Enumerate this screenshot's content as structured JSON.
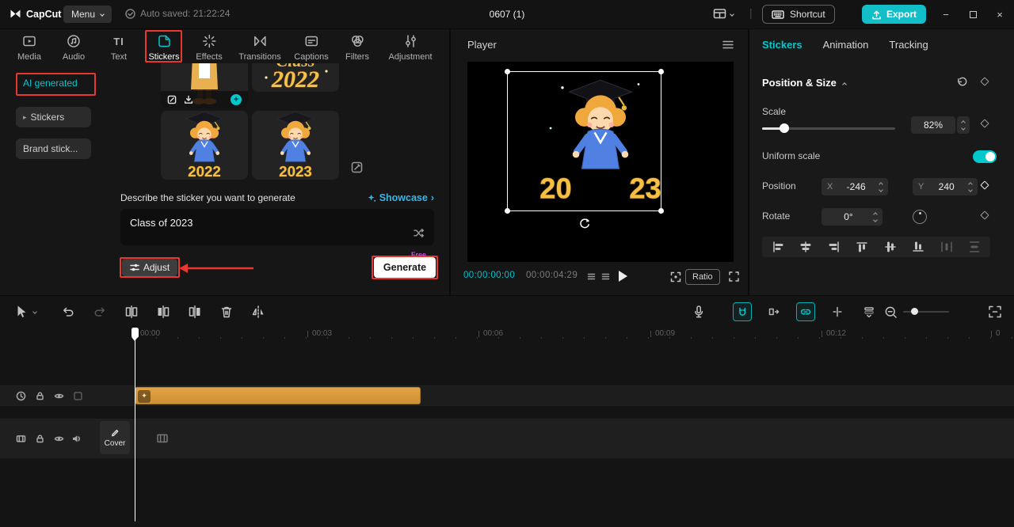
{
  "colors": {
    "accent": "#00c8cd",
    "annotation_red": "#e8382e",
    "clip_orange": "#d8993b"
  },
  "icons": {
    "text_tab_glyph": "TI",
    "minimize_glyph": "−",
    "close_glyph": "×",
    "sidebar_caret": "▸",
    "showcase_chevron": "›",
    "plus_glyph": "+"
  },
  "topbar": {
    "logo_text": "CapCut",
    "menu_label": "Menu",
    "autosave_text": "Auto saved: 21:22:24",
    "project_title": "0607 (1)",
    "shortcut_label": "Shortcut",
    "export_label": "Export"
  },
  "media_tabs": [
    {
      "label": "Media"
    },
    {
      "label": "Audio"
    },
    {
      "label": "Text"
    },
    {
      "label": "Stickers"
    },
    {
      "label": "Effects"
    },
    {
      "label": "Transitions"
    },
    {
      "label": "Captions"
    },
    {
      "label": "Filters"
    },
    {
      "label": "Adjustment"
    }
  ],
  "sidebar": {
    "items": [
      {
        "label": "AI generated"
      },
      {
        "label": "Stickers"
      },
      {
        "label": "Brand stick..."
      }
    ]
  },
  "library": {
    "thumb2_title": "Class",
    "thumb2_year": "2022",
    "thumb3_year": "2022",
    "thumb4_year": "2023"
  },
  "generator": {
    "describe_label": "Describe the sticker you want to generate",
    "showcase_label": "Showcase",
    "prompt_value": "Class of 2023",
    "adjust_label": "Adjust",
    "generate_label": "Generate",
    "free_badge": "Free"
  },
  "player": {
    "title": "Player",
    "current_time": "00:00:00:00",
    "duration": "00:00:04:29",
    "ratio_label": "Ratio",
    "sticker_year_left": "20",
    "sticker_year_right": "23"
  },
  "properties": {
    "tabs": [
      {
        "label": "Stickers"
      },
      {
        "label": "Animation"
      },
      {
        "label": "Tracking"
      }
    ],
    "section_title": "Position & Size",
    "scale_label": "Scale",
    "scale_value": "82%",
    "uniform_scale_label": "Uniform scale",
    "position_label": "Position",
    "x_label": "X",
    "x_value": "-246",
    "y_label": "Y",
    "y_value": "240",
    "rotate_label": "Rotate",
    "rotate_value": "0°"
  },
  "timeline": {
    "ruler_labels": [
      "00:00",
      "00:03",
      "00:06",
      "00:09",
      "00:12",
      "0"
    ],
    "cover_label": "Cover"
  }
}
